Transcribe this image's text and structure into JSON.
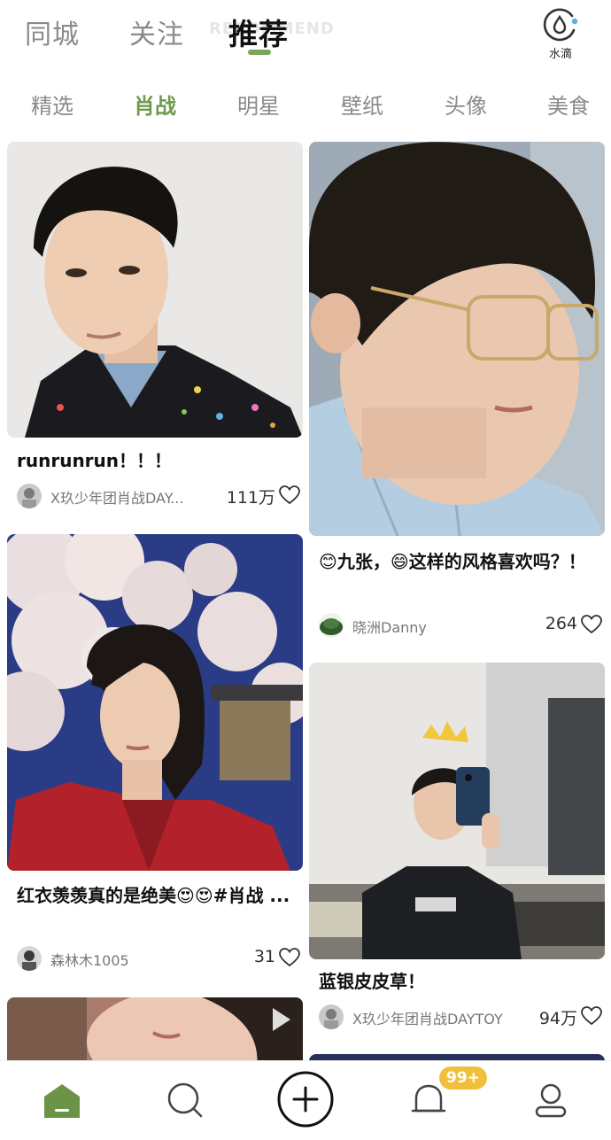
{
  "top_tabs": [
    {
      "label": "同城",
      "active": false
    },
    {
      "label": "关注",
      "active": false
    },
    {
      "label": "推荐",
      "active": true
    }
  ],
  "top_tab_ghost": "RECOMMEND",
  "water_button": {
    "label": "水滴",
    "icon": "water-drop-icon"
  },
  "categories": [
    {
      "label": "精选",
      "active": false
    },
    {
      "label": "肖战",
      "active": true
    },
    {
      "label": "明星",
      "active": false
    },
    {
      "label": "壁纸",
      "active": false
    },
    {
      "label": "头像",
      "active": false
    },
    {
      "label": "美食",
      "active": false
    }
  ],
  "feed": [
    {
      "title": "runrunrun！！！",
      "author": "X玖少年团肖战DAY...",
      "likes": "111万"
    },
    {
      "title": "😊九张，😄这样的风格喜欢吗？！",
      "author": "晓洲Danny",
      "likes": "264"
    },
    {
      "title": "红衣羡羡真的是绝美😍😍#肖战 ...",
      "author": "森林木1005",
      "likes": "31"
    },
    {
      "title": "蓝银皮皮草！",
      "author": "X玖少年团肖战DAYTOY",
      "likes": "94万"
    },
    {
      "title": "",
      "author": "",
      "likes": ""
    }
  ],
  "bottom_nav": {
    "items": [
      {
        "icon": "home-icon",
        "active": true
      },
      {
        "icon": "discover-icon",
        "active": false
      },
      {
        "icon": "add-post-icon",
        "active": false
      },
      {
        "icon": "notification-bell-icon",
        "active": false
      },
      {
        "icon": "profile-icon",
        "active": false
      }
    ],
    "notification_badge": "99+"
  },
  "colors": {
    "accent": "#7aa65a",
    "category_active": "#6e9a4e",
    "badge": "#f0bf3c",
    "text_muted": "#8a8a8a"
  }
}
